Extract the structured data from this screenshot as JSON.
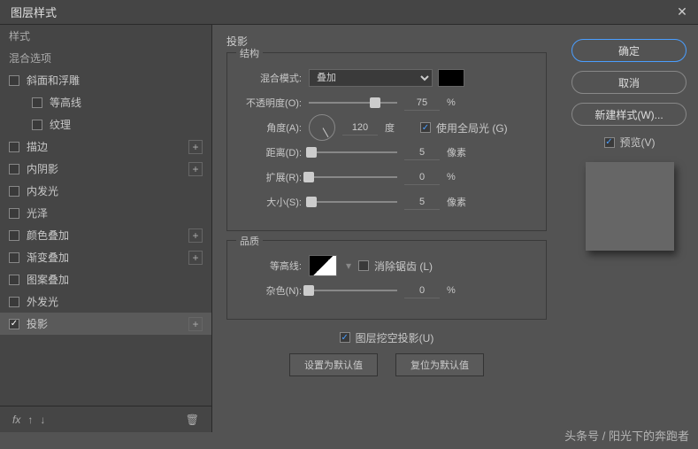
{
  "titlebar": {
    "title": "图层样式"
  },
  "sidebar": {
    "styles_label": "样式",
    "blend_options_label": "混合选项",
    "bevel_emboss": "斜面和浮雕",
    "contour": "等高线",
    "texture": "纹理",
    "stroke": "描边",
    "inner_shadow": "内阴影",
    "inner_glow": "内发光",
    "satin": "光泽",
    "color_overlay": "颜色叠加",
    "gradient_overlay": "渐变叠加",
    "pattern_overlay": "图案叠加",
    "outer_glow": "外发光",
    "drop_shadow": "投影",
    "fx_label": "fx"
  },
  "panel": {
    "title": "投影",
    "structure_title": "结构",
    "blend_mode_label": "混合模式:",
    "blend_mode_value": "叠加",
    "opacity_label": "不透明度(O):",
    "opacity_value": "75",
    "opacity_unit": "%",
    "angle_label": "角度(A):",
    "angle_value": "120",
    "angle_unit": "度",
    "global_light_label": "使用全局光 (G)",
    "distance_label": "距离(D):",
    "distance_value": "5",
    "distance_unit": "像素",
    "spread_label": "扩展(R):",
    "spread_value": "0",
    "spread_unit": "%",
    "size_label": "大小(S):",
    "size_value": "5",
    "size_unit": "像素",
    "quality_title": "品质",
    "contour_label": "等高线:",
    "antialias_label": "消除锯齿 (L)",
    "noise_label": "杂色(N):",
    "noise_value": "0",
    "noise_unit": "%",
    "knockout_label": "图层挖空投影(U)",
    "set_default": "设置为默认值",
    "reset_default": "复位为默认值"
  },
  "buttons": {
    "ok": "确定",
    "cancel": "取消",
    "new_style": "新建样式(W)...",
    "preview": "预览(V)"
  },
  "watermark": "头条号 / 阳光下的奔跑者"
}
